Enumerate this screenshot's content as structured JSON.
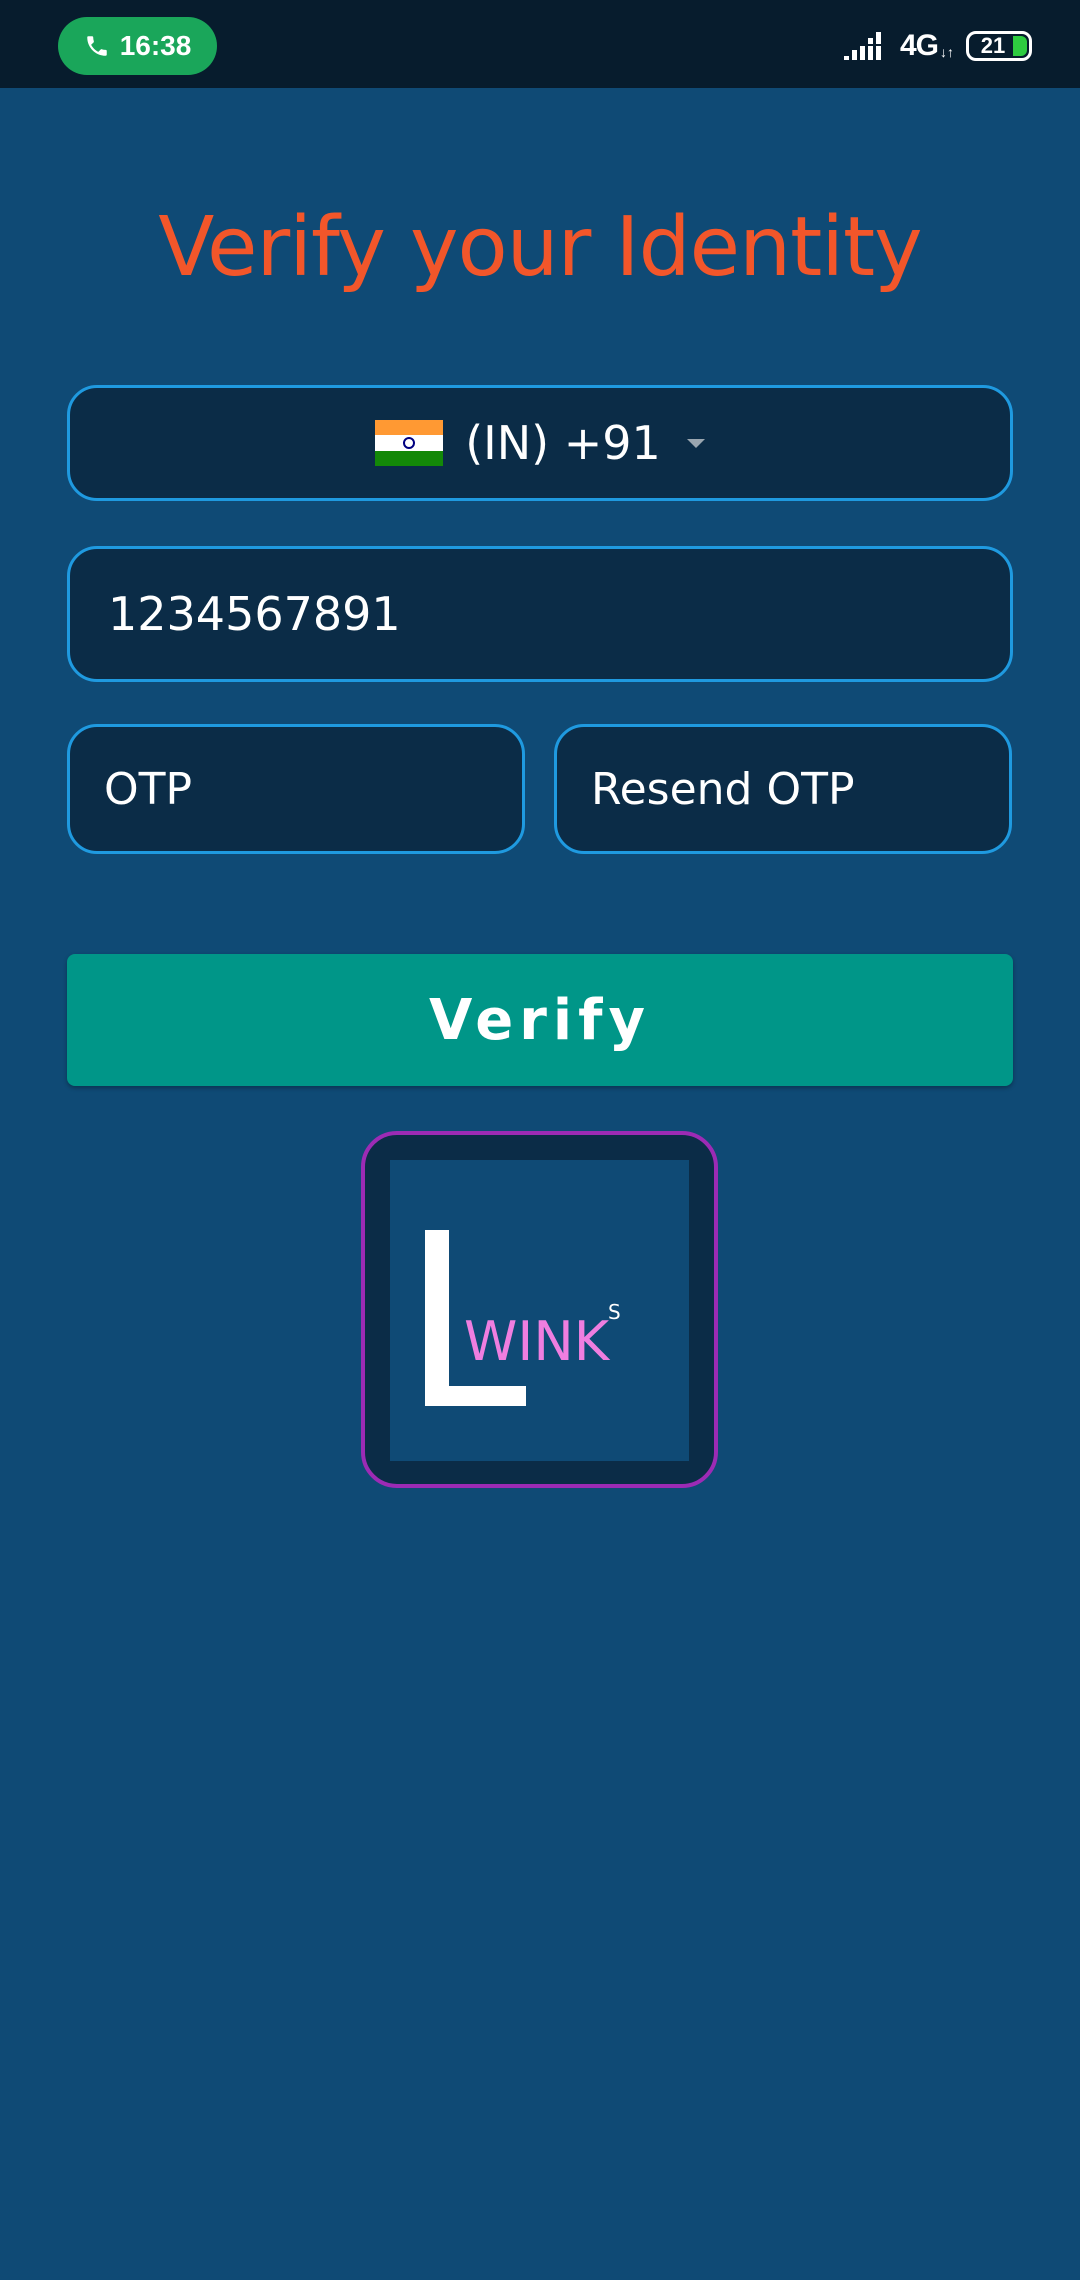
{
  "status_bar": {
    "call_time": "16:38",
    "network": "4G",
    "network_arrows": "↓↑",
    "battery": "21",
    "icons": [
      "phone-icon",
      "signal-icon",
      "battery-icon"
    ]
  },
  "page": {
    "title": "Verify your Identity"
  },
  "country_picker": {
    "flag": "india-flag-icon",
    "value": "(IN) +91"
  },
  "phone": {
    "value": "1234567891"
  },
  "otp": {
    "placeholder": "OTP"
  },
  "resend": {
    "label": "Resend OTP"
  },
  "verify_button": {
    "label": "Verify"
  },
  "logo": {
    "wink_text": "WINK",
    "superscript": "S",
    "colors": {
      "frame_border": "#9c2bb5",
      "wink_text": "#ef7ee0"
    }
  },
  "colors": {
    "background": "#0f4a75",
    "title": "#f2562a",
    "field_border": "#1f9ae0",
    "button": "#009688"
  }
}
